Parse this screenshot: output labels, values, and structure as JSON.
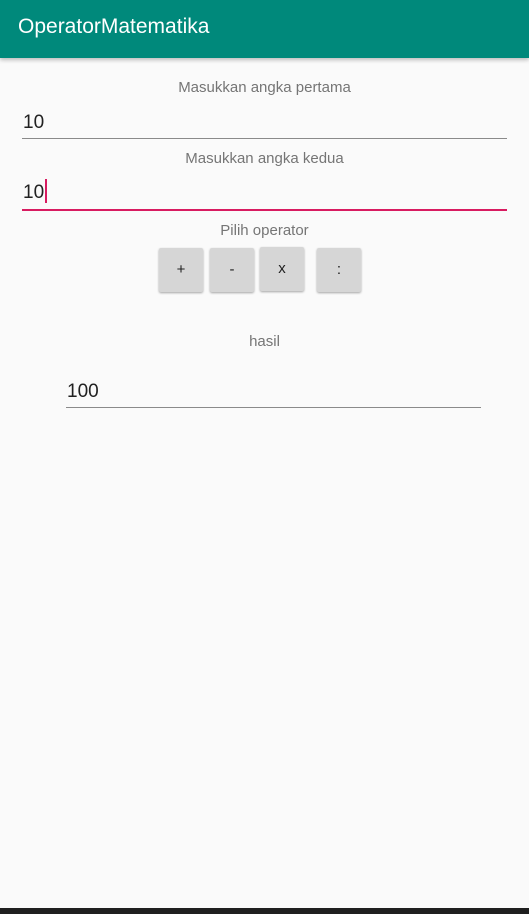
{
  "app_bar": {
    "title": "OperatorMatematika",
    "color": "#00897b"
  },
  "first_number": {
    "label": "Masukkan  angka pertama",
    "value": "10"
  },
  "second_number": {
    "label": "Masukkan  angka kedua",
    "value": "10",
    "focused": true
  },
  "operator": {
    "label": "Pilih operator",
    "buttons": [
      "+",
      "-",
      "x",
      ":"
    ]
  },
  "result": {
    "label": "hasil",
    "value": "100"
  },
  "colors": {
    "accent": "#d81b60",
    "primary": "#00897b"
  }
}
